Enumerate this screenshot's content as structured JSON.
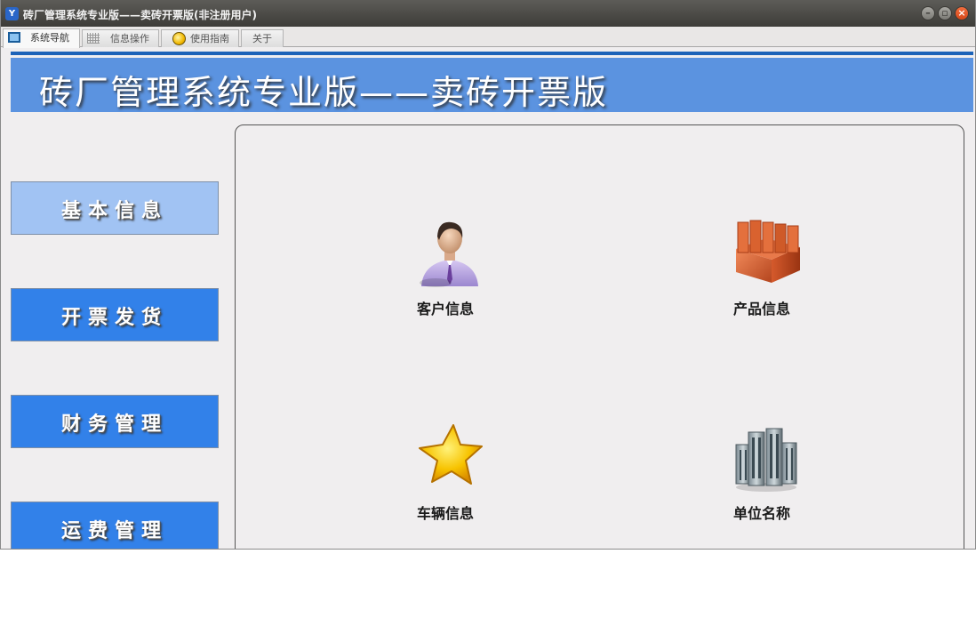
{
  "window": {
    "title": "砖厂管理系统专业版——卖砖开票版(非注册用户)",
    "app_icon_text": "Y"
  },
  "tabs": [
    {
      "label": "系统导航",
      "icon": "monitor-icon",
      "active": true
    },
    {
      "label": "信息操作",
      "icon": "grid-icon",
      "active": false
    },
    {
      "label": "使用指南",
      "icon": "help-coin-icon",
      "active": false
    },
    {
      "label": "关于",
      "icon": "",
      "active": false
    }
  ],
  "banner": {
    "title": "砖厂管理系统专业版——卖砖开票版"
  },
  "nav": [
    {
      "label": "基本信息",
      "selected": true
    },
    {
      "label": "开票发货",
      "selected": false
    },
    {
      "label": "财务管理",
      "selected": false
    },
    {
      "label": "运费管理",
      "selected": false
    }
  ],
  "tiles": [
    {
      "label": "客户信息",
      "icon": "customer-person-icon"
    },
    {
      "label": "产品信息",
      "icon": "bricks-icon"
    },
    {
      "label": "车辆信息",
      "icon": "star-icon"
    },
    {
      "label": "单位名称",
      "icon": "buildings-icon"
    }
  ],
  "colors": {
    "banner_blue": "#5b93e0",
    "nav_blue": "#3281e9",
    "nav_selected": "#a1c3f3"
  }
}
